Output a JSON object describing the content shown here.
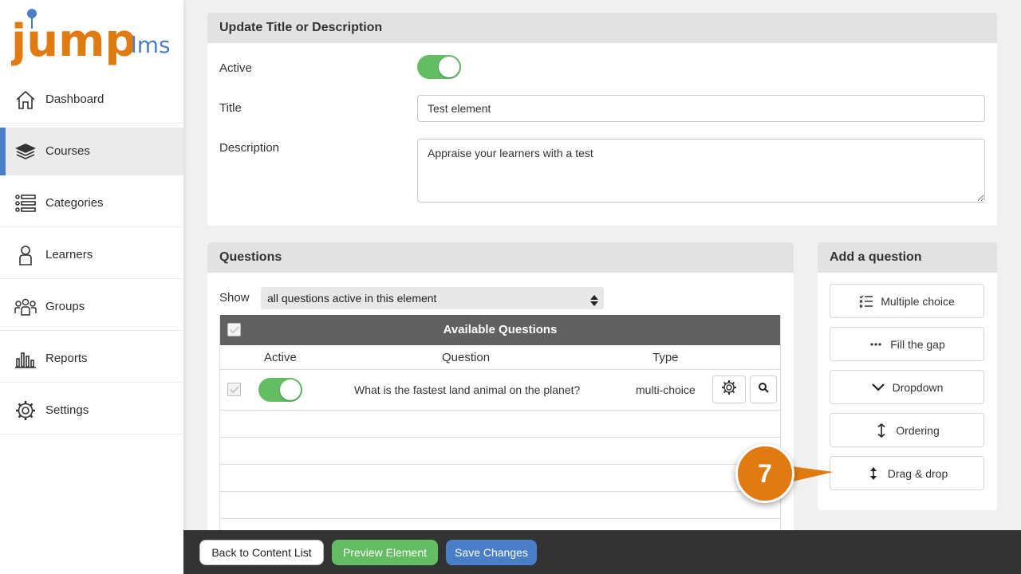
{
  "brand": {
    "logo_main": "jump",
    "logo_sub": "lms",
    "main_color": "#e07b12",
    "sub_color": "#4a7fc7"
  },
  "sidebar": {
    "items": [
      {
        "label": "Dashboard",
        "icon": "home-icon"
      },
      {
        "label": "Courses",
        "icon": "books-icon",
        "active": true
      },
      {
        "label": "Categories",
        "icon": "list-icon"
      },
      {
        "label": "Learners",
        "icon": "person-icon"
      },
      {
        "label": "Groups",
        "icon": "group-icon"
      },
      {
        "label": "Reports",
        "icon": "bar-chart-icon"
      },
      {
        "label": "Settings",
        "icon": "gear-icon"
      }
    ]
  },
  "update_panel": {
    "title": "Update Title or Description",
    "active_label": "Active",
    "active": true,
    "title_label": "Title",
    "title_value": "Test element",
    "description_label": "Description",
    "description_value": "Appraise your learners with a test"
  },
  "questions_panel": {
    "title": "Questions",
    "show_label": "Show",
    "show_value": "all questions active in this element",
    "table_title": "Available Questions",
    "columns": [
      "Active",
      "Question",
      "Type"
    ],
    "rows": [
      {
        "active": true,
        "question": "What is the fastest land animal on the planet?",
        "type": "multi-choice"
      }
    ]
  },
  "add_question_panel": {
    "title": "Add a question",
    "buttons": [
      {
        "label": "Multiple choice",
        "icon": "checklist-icon"
      },
      {
        "label": "Fill the gap",
        "icon": "ellipsis-icon"
      },
      {
        "label": "Dropdown",
        "icon": "chevron-down-icon"
      },
      {
        "label": "Ordering",
        "icon": "vertical-arrows-icon"
      },
      {
        "label": "Drag & drop",
        "icon": "drag-arrows-icon"
      }
    ]
  },
  "footer": {
    "back_label": "Back to Content List",
    "preview_label": "Preview Element",
    "save_label": "Save Changes"
  },
  "callout": {
    "number": "7",
    "color": "#e07b12"
  }
}
